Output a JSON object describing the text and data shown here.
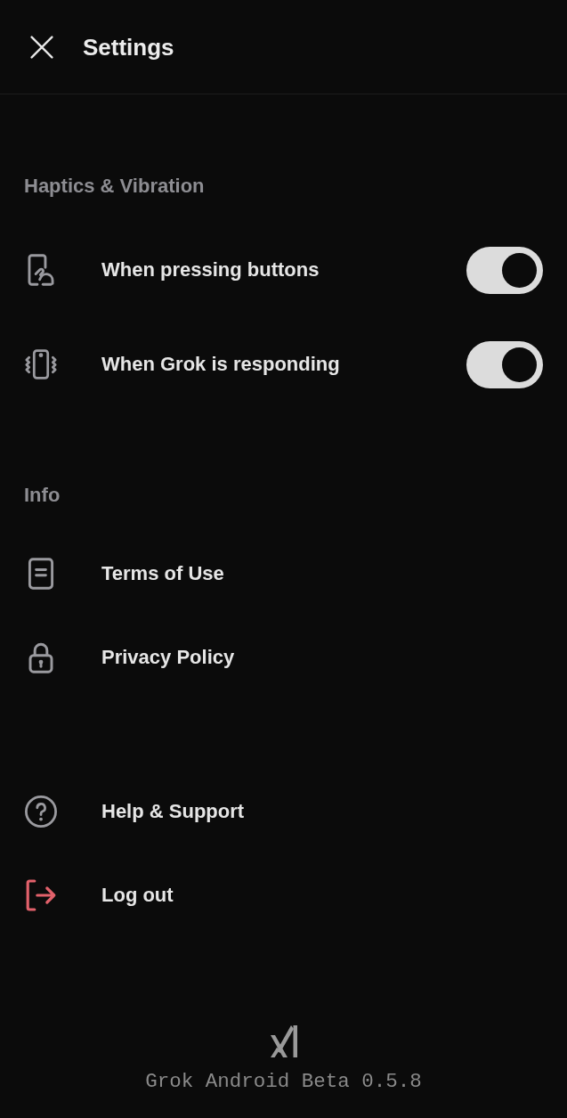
{
  "header": {
    "title": "Settings"
  },
  "sections": [
    {
      "title": "Haptics & Vibration",
      "items": [
        {
          "kind": "toggle",
          "label": "When pressing buttons",
          "on": true
        },
        {
          "kind": "toggle",
          "label": "When Grok is responding",
          "on": true
        }
      ]
    },
    {
      "title": "Info",
      "items": [
        {
          "kind": "link",
          "label": "Terms of Use"
        },
        {
          "kind": "link",
          "label": "Privacy Policy"
        }
      ]
    },
    {
      "items": [
        {
          "kind": "link",
          "label": "Help & Support"
        },
        {
          "kind": "danger",
          "label": "Log out"
        }
      ]
    }
  ],
  "footer": {
    "version": "Grok Android Beta 0.5.8"
  }
}
